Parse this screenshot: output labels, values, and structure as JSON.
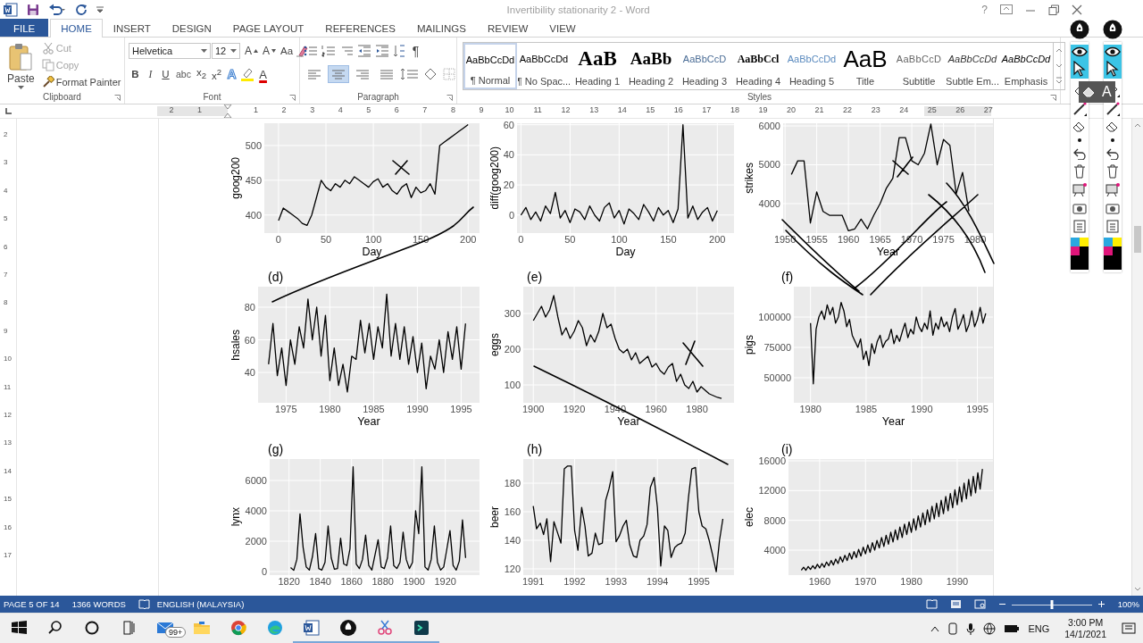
{
  "window": {
    "title": "Invertibility stationarity 2 - Word",
    "help": "?"
  },
  "tabs": [
    {
      "label": "FILE",
      "kind": "file",
      "selected": false
    },
    {
      "label": "HOME",
      "kind": "tab",
      "selected": true
    },
    {
      "label": "INSERT",
      "kind": "tab",
      "selected": false
    },
    {
      "label": "DESIGN",
      "kind": "tab",
      "selected": false
    },
    {
      "label": "PAGE LAYOUT",
      "kind": "tab",
      "selected": false
    },
    {
      "label": "REFERENCES",
      "kind": "tab",
      "selected": false
    },
    {
      "label": "MAILINGS",
      "kind": "tab",
      "selected": false
    },
    {
      "label": "REVIEW",
      "kind": "tab",
      "selected": false
    },
    {
      "label": "VIEW",
      "kind": "tab",
      "selected": false
    }
  ],
  "clipboard": {
    "group": "Clipboard",
    "paste": "Paste",
    "items": [
      {
        "label": "Cut",
        "kind": "cut",
        "disabled": true
      },
      {
        "label": "Copy",
        "kind": "copy",
        "disabled": true
      },
      {
        "label": "Format Painter",
        "kind": "painter",
        "disabled": false
      }
    ]
  },
  "font": {
    "group": "Font",
    "name": "Helvetica",
    "size": "12",
    "row1": [
      {
        "label": "A",
        "kind": "grow"
      },
      {
        "label": "A",
        "kind": "shrink"
      },
      {
        "label": "Aa",
        "kind": "case"
      }
    ],
    "row2": [
      {
        "label": "B",
        "kind": "bold"
      },
      {
        "label": "I",
        "kind": "italic"
      },
      {
        "label": "U",
        "kind": "underline"
      },
      {
        "label": "abc",
        "kind": "strike"
      },
      {
        "label": "x$_{2}$",
        "kind": "subscript"
      },
      {
        "label": "x$^{2}$",
        "kind": "superscript"
      },
      {
        "label": "A",
        "kind": "effects"
      },
      {
        "label": "A",
        "kind": "color"
      }
    ]
  },
  "paragraph": {
    "group": "Paragraph",
    "marks": "¶",
    "align": [
      {
        "selected": false
      },
      {
        "selected": true
      },
      {
        "selected": false
      },
      {
        "selected": false
      }
    ]
  },
  "styles": {
    "group": "Styles",
    "items": [
      {
        "sample": "AaBbCcDd",
        "name": "¶ Normal",
        "kind": "normal",
        "selected": true
      },
      {
        "sample": "AaBbCcDd",
        "name": "¶ No Spac...",
        "kind": "plain",
        "selected": false
      },
      {
        "sample": "AaB",
        "name": "Heading 1",
        "kind": "heading1",
        "selected": false
      },
      {
        "sample": "AaBb",
        "name": "Heading 2",
        "kind": "heading2",
        "selected": false
      },
      {
        "sample": "AaBbCcD",
        "name": "Heading 3",
        "kind": "heading3",
        "selected": false
      },
      {
        "sample": "AaBbCcl",
        "name": "Heading 4",
        "kind": "heading4",
        "selected": false
      },
      {
        "sample": "AaBbCcDd",
        "name": "Heading 5",
        "kind": "heading5",
        "selected": false
      },
      {
        "sample": "AaB",
        "name": "Title",
        "kind": "title",
        "selected": false
      },
      {
        "sample": "AaBbCcD",
        "name": "Subtitle",
        "kind": "subtitle",
        "selected": false
      },
      {
        "sample": "AaBbCcDd",
        "name": "Subtle Em...",
        "kind": "subtle",
        "selected": false
      },
      {
        "sample": "AaBbCcDd",
        "name": "Emphasis",
        "kind": "emphasis",
        "selected": false
      }
    ]
  },
  "ruler": {
    "marks": [
      "2",
      "1",
      "1",
      "2",
      "3",
      "4",
      "5",
      "6",
      "7",
      "8",
      "9",
      "10",
      "11",
      "12",
      "13",
      "14",
      "15",
      "16",
      "17",
      "18",
      "19",
      "20",
      "21",
      "22",
      "23",
      "24",
      "25",
      "26",
      "27"
    ]
  },
  "vertical_ruler": {
    "marks": [
      "2",
      "3",
      "4",
      "5",
      "6",
      "7",
      "8",
      "9",
      "10",
      "11",
      "12",
      "13",
      "14",
      "15",
      "16",
      "17"
    ]
  },
  "panels": [
    {
      "chart_data": {
        "type": "line",
        "xlabel": "Day",
        "ylabel": "goog200",
        "grid": true,
        "xlim": [
          -15,
          212
        ],
        "ylim": [
          374,
          532
        ],
        "xticks": [
          0,
          50,
          100,
          150,
          200
        ],
        "yticks": [
          500,
          450,
          400
        ],
        "x": [
          0,
          5,
          10,
          15,
          20,
          25,
          30,
          35,
          40,
          45,
          50,
          55,
          60,
          65,
          70,
          75,
          80,
          85,
          90,
          95,
          100,
          105,
          110,
          115,
          120,
          125,
          130,
          135,
          140,
          145,
          150,
          155,
          160,
          165,
          170,
          175,
          180,
          185,
          190,
          195,
          200
        ],
        "series": [
          {
            "color": "#000000",
            "values": [
              392,
              410,
              405,
              400,
              395,
              388,
              385,
              400,
              425,
              450,
              440,
              435,
              445,
              440,
              450,
              445,
              455,
              450,
              445,
              440,
              448,
              452,
              440,
              445,
              435,
              430,
              440,
              445,
              425,
              440,
              432,
              435,
              445,
              430,
              500,
              505,
              510,
              515,
              520,
              525,
              530
            ]
          }
        ]
      }
    },
    {
      "chart_data": {
        "type": "line",
        "xlabel": "Day",
        "ylabel": "diff(goog200)",
        "grid": true,
        "xlim": [
          -4,
          217
        ],
        "ylim": [
          -12,
          61
        ],
        "xticks": [
          0,
          50,
          100,
          150,
          200
        ],
        "yticks": [
          60,
          40,
          20,
          0
        ],
        "x": [
          0,
          5,
          10,
          15,
          20,
          25,
          30,
          35,
          40,
          45,
          50,
          55,
          60,
          65,
          70,
          75,
          80,
          85,
          90,
          95,
          100,
          105,
          110,
          115,
          120,
          125,
          130,
          135,
          140,
          145,
          150,
          155,
          160,
          165,
          170,
          175,
          180,
          185,
          190,
          195,
          200
        ],
        "series": [
          {
            "color": "#000000",
            "values": [
              0,
              5,
              -3,
              2,
              -4,
              6,
              1,
              15,
              -2,
              3,
              -5,
              4,
              2,
              -3,
              6,
              0,
              -4,
              5,
              8,
              -2,
              3,
              -6,
              4,
              1,
              -3,
              7,
              2,
              -4,
              5,
              0,
              3,
              -5,
              4,
              60,
              -2,
              6,
              -3,
              2,
              5,
              -4,
              3
            ]
          }
        ]
      }
    },
    {
      "chart_data": {
        "type": "line",
        "xlabel": "Year",
        "ylabel": "strikes",
        "grid": true,
        "xlim": [
          1949.7,
          1982.8
        ],
        "ylim": [
          3241,
          6069
        ],
        "xticks": [
          1950,
          1955,
          1960,
          1965,
          1970,
          1975,
          1980
        ],
        "yticks": [
          6000,
          5000,
          4000
        ],
        "x": [
          1951,
          1952,
          1953,
          1954,
          1955,
          1956,
          1957,
          1958,
          1959,
          1960,
          1961,
          1962,
          1963,
          1964,
          1965,
          1966,
          1967,
          1968,
          1969,
          1970,
          1971,
          1972,
          1973,
          1974,
          1975,
          1976,
          1977,
          1978,
          1979
        ],
        "series": [
          {
            "color": "#000000",
            "values": [
              4750,
              5100,
              5100,
              3500,
              4300,
              3800,
              3700,
              3700,
              3700,
              3300,
              3350,
              3600,
              3350,
              3700,
              4000,
              4400,
              4650,
              5700,
              5700,
              5100,
              5000,
              5300,
              6050,
              5000,
              5650,
              5500,
              4250,
              4800,
              3800
            ]
          }
        ]
      }
    },
    {
      "label": "(d)",
      "chart_data": {
        "type": "line",
        "xlabel": "Year",
        "ylabel": "hsales",
        "grid": true,
        "xlim": [
          1971.8,
          1997.1
        ],
        "ylim": [
          21.4,
          92.6
        ],
        "xticks": [
          1975,
          1980,
          1985,
          1990,
          1995
        ],
        "yticks": [
          80,
          60,
          40
        ],
        "x": [
          1973,
          1973.5,
          1974,
          1974.5,
          1975,
          1975.5,
          1976,
          1976.5,
          1977,
          1977.5,
          1978,
          1978.5,
          1979,
          1979.5,
          1980,
          1980.5,
          1981,
          1981.5,
          1982,
          1982.5,
          1983,
          1983.5,
          1984,
          1984.5,
          1985,
          1985.5,
          1986,
          1986.5,
          1987,
          1987.5,
          1988,
          1988.5,
          1989,
          1989.5,
          1990,
          1990.5,
          1991,
          1991.5,
          1992,
          1992.5,
          1993,
          1993.5,
          1994,
          1994.5,
          1995,
          1995.5
        ],
        "series": [
          {
            "color": "#000000",
            "values": [
              45,
              70,
              38,
              55,
              32,
              60,
              45,
              68,
              55,
              85,
              60,
              80,
              50,
              75,
              35,
              55,
              32,
              45,
              28,
              50,
              48,
              72,
              52,
              70,
              48,
              68,
              55,
              88,
              50,
              70,
              48,
              68,
              45,
              62,
              40,
              58,
              30,
              50,
              42,
              60,
              40,
              65,
              48,
              68,
              42,
              70
            ]
          }
        ]
      }
    },
    {
      "label": "(e)",
      "chart_data": {
        "type": "line",
        "xlabel": "Year",
        "ylabel": "eggs",
        "grid": true,
        "xlim": [
          1895.1,
          1998.1
        ],
        "ylim": [
          50,
          375
        ],
        "xticks": [
          1900,
          1920,
          1940,
          1960,
          1980
        ],
        "yticks": [
          300,
          200,
          100
        ],
        "x": [
          1900,
          1902,
          1904,
          1906,
          1908,
          1910,
          1912,
          1914,
          1916,
          1918,
          1920,
          1922,
          1924,
          1926,
          1928,
          1930,
          1932,
          1934,
          1936,
          1938,
          1940,
          1942,
          1944,
          1946,
          1948,
          1950,
          1952,
          1954,
          1956,
          1958,
          1960,
          1962,
          1964,
          1966,
          1968,
          1970,
          1972,
          1974,
          1976,
          1978,
          1980,
          1982,
          1984,
          1986,
          1988,
          1990,
          1992
        ],
        "series": [
          {
            "color": "#000000",
            "values": [
              280,
              300,
              320,
              290,
              310,
              350,
              290,
              240,
              260,
              230,
              250,
              280,
              260,
              210,
              240,
              220,
              250,
              300,
              260,
              270,
              230,
              200,
              190,
              200,
              170,
              190,
              160,
              170,
              180,
              150,
              160,
              140,
              130,
              150,
              160,
              110,
              130,
              100,
              90,
              110,
              80,
              95,
              85,
              75,
              70,
              65,
              62
            ]
          }
        ]
      }
    },
    {
      "label": "(f)",
      "chart_data": {
        "type": "line",
        "xlabel": "Year",
        "ylabel": "pigs",
        "grid": true,
        "xlim": [
          1978.5,
          1996.4
        ],
        "ylim": [
          29420,
          125000
        ],
        "xticks": [
          1980,
          1985,
          1990,
          1995
        ],
        "yticks": [
          100000,
          75000,
          50000
        ],
        "x": [
          1980,
          1980.25,
          1980.5,
          1980.75,
          1981,
          1981.25,
          1981.5,
          1981.75,
          1982,
          1982.25,
          1982.5,
          1982.75,
          1983,
          1983.25,
          1983.5,
          1983.75,
          1984,
          1984.25,
          1984.5,
          1984.75,
          1985,
          1985.25,
          1985.5,
          1985.75,
          1986,
          1986.25,
          1986.5,
          1986.75,
          1987,
          1987.25,
          1987.5,
          1987.75,
          1988,
          1988.25,
          1988.5,
          1988.75,
          1989,
          1989.25,
          1989.5,
          1989.75,
          1990,
          1990.25,
          1990.5,
          1990.75,
          1991,
          1991.25,
          1991.5,
          1991.75,
          1992,
          1992.25,
          1992.5,
          1992.75,
          1993,
          1993.25,
          1993.5,
          1993.75,
          1994,
          1994.25,
          1994.5,
          1994.75,
          1995,
          1995.25,
          1995.5,
          1995.75
        ],
        "series": [
          {
            "color": "#000000",
            "values": [
              95000,
              45000,
              90000,
              100000,
              105000,
              98000,
              110000,
              102000,
              108000,
              95000,
              100000,
              112000,
              105000,
              92000,
              98000,
              85000,
              80000,
              75000,
              82000,
              65000,
              72000,
              60000,
              78000,
              70000,
              80000,
              85000,
              75000,
              80000,
              82000,
              90000,
              78000,
              85000,
              80000,
              88000,
              95000,
              83000,
              90000,
              86000,
              100000,
              92000,
              88000,
              95000,
              90000,
              105000,
              85000,
              95000,
              90000,
              100000,
              92000,
              96000,
              88000,
              100000,
              107000,
              90000,
              95000,
              102000,
              88000,
              94000,
              105000,
              92000,
              98000,
              108000,
              95000,
              103000
            ]
          }
        ]
      }
    },
    {
      "label": "(g)",
      "chart_data": {
        "type": "line",
        "ylabel": "lynx",
        "grid": true,
        "xlim": [
          1807.6,
          1941.9
        ],
        "ylim": [
          -235,
          7411
        ],
        "xticks": [
          1820,
          1840,
          1860,
          1880,
          1900,
          1920
        ],
        "yticks": [
          6000,
          4000,
          2000,
          0
        ],
        "x": [
          1821,
          1823,
          1825,
          1827,
          1829,
          1831,
          1833,
          1835,
          1837,
          1839,
          1841,
          1843,
          1845,
          1847,
          1849,
          1851,
          1853,
          1855,
          1857,
          1859,
          1861,
          1863,
          1865,
          1867,
          1869,
          1871,
          1873,
          1875,
          1877,
          1879,
          1881,
          1883,
          1885,
          1887,
          1889,
          1891,
          1893,
          1895,
          1897,
          1899,
          1901,
          1903,
          1905,
          1907,
          1909,
          1911,
          1913,
          1915,
          1917,
          1919,
          1921,
          1923,
          1925,
          1927,
          1929,
          1931,
          1933
        ],
        "series": [
          {
            "color": "#000000",
            "values": [
              270,
              80,
              800,
              3800,
              1600,
              300,
              100,
              1000,
              2500,
              200,
              100,
              600,
              3000,
              900,
              150,
              200,
              2200,
              500,
              400,
              1500,
              6900,
              500,
              200,
              800,
              2400,
              400,
              100,
              1100,
              2100,
              300,
              200,
              900,
              3000,
              400,
              200,
              600,
              2600,
              800,
              200,
              600,
              4000,
              2500,
              6900,
              300,
              100,
              800,
              3000,
              600,
              100,
              300,
              1500,
              2700,
              400,
              100,
              700,
              3400,
              900
            ]
          }
        ]
      }
    },
    {
      "label": "(h)",
      "chart_data": {
        "type": "line",
        "ylabel": "beer",
        "grid": true,
        "xlim": [
          1990.76,
          1995.85
        ],
        "ylim": [
          115.6,
          196.9
        ],
        "xticks": [
          1991,
          1992,
          1993,
          1994,
          1995
        ],
        "yticks": [
          180,
          160,
          140,
          120
        ],
        "x": [
          1991,
          1991.08,
          1991.17,
          1991.25,
          1991.33,
          1991.42,
          1991.5,
          1991.58,
          1991.67,
          1991.75,
          1991.83,
          1991.92,
          1992,
          1992.08,
          1992.17,
          1992.25,
          1992.33,
          1992.42,
          1992.5,
          1992.58,
          1992.67,
          1992.75,
          1992.83,
          1992.92,
          1993,
          1993.08,
          1993.17,
          1993.25,
          1993.33,
          1993.42,
          1993.5,
          1993.58,
          1993.67,
          1993.75,
          1993.83,
          1993.92,
          1994,
          1994.08,
          1994.17,
          1994.25,
          1994.33,
          1994.42,
          1994.5,
          1994.58,
          1994.67,
          1994.75,
          1994.83,
          1994.92,
          1995,
          1995.08,
          1995.17,
          1995.25,
          1995.33,
          1995.42,
          1995.5,
          1995.58
        ],
        "series": [
          {
            "color": "#000000",
            "values": [
              164,
              148,
              152,
              144,
              155,
              125,
              153,
              146,
              138,
              190,
              192,
              192,
              147,
              133,
              163,
              150,
              129,
              131,
              145,
              137,
              138,
              168,
              176,
              188,
              139,
              143,
              150,
              154,
              137,
              129,
              128,
              140,
              143,
              151,
              177,
              184,
              163,
              122,
              150,
              147,
              128,
              135,
              137,
              138,
              145,
              170,
              190,
              191,
              160,
              150,
              148,
              140,
              130,
              118,
              140,
              155
            ]
          }
        ]
      }
    },
    {
      "label": "(i)",
      "chart_data": {
        "type": "line",
        "ylabel": "elec",
        "grid": true,
        "xlim": [
          1953.2,
          1997.8
        ],
        "ylim": [
          640,
          16240
        ],
        "xticks": [
          1960,
          1970,
          1980,
          1990
        ],
        "yticks": [
          16000,
          12000,
          8000,
          4000
        ],
        "x": [
          1956,
          1956.5,
          1957,
          1957.5,
          1958,
          1958.5,
          1959,
          1959.5,
          1960,
          1960.5,
          1961,
          1961.5,
          1962,
          1962.5,
          1963,
          1963.5,
          1964,
          1964.5,
          1965,
          1965.5,
          1966,
          1966.5,
          1967,
          1967.5,
          1968,
          1968.5,
          1969,
          1969.5,
          1970,
          1970.5,
          1971,
          1971.5,
          1972,
          1972.5,
          1973,
          1973.5,
          1974,
          1974.5,
          1975,
          1975.5,
          1976,
          1976.5,
          1977,
          1977.5,
          1978,
          1978.5,
          1979,
          1979.5,
          1980,
          1980.5,
          1981,
          1981.5,
          1982,
          1982.5,
          1983,
          1983.5,
          1984,
          1984.5,
          1985,
          1985.5,
          1986,
          1986.5,
          1987,
          1987.5,
          1988,
          1988.5,
          1989,
          1989.5,
          1990,
          1990.5,
          1991,
          1991.5,
          1992,
          1992.5,
          1993,
          1993.5,
          1994,
          1994.5,
          1995,
          1995.5
        ],
        "series": [
          {
            "color": "#000000",
            "values": [
              1300,
              1700,
              1300,
              1800,
              1400,
              1900,
              1500,
              2100,
              1600,
              2200,
              1700,
              2400,
              1900,
              2600,
              2000,
              2800,
              2200,
              3100,
              2400,
              3300,
              2600,
              3600,
              2800,
              3800,
              3000,
              4100,
              3200,
              4400,
              3500,
              4700,
              3700,
              5000,
              4000,
              5300,
              4300,
              5700,
              4500,
              6000,
              4800,
              6400,
              5100,
              6700,
              5400,
              7100,
              5700,
              7500,
              6100,
              7800,
              6400,
              8200,
              6700,
              8600,
              7100,
              9000,
              7400,
              9400,
              7800,
              9900,
              8200,
              10300,
              8500,
              10700,
              8900,
              11200,
              9300,
              11600,
              9700,
              12100,
              10100,
              12500,
              10500,
              13000,
              10900,
              13500,
              11300,
              13900,
              11700,
              14400,
              12200,
              14900
            ]
          }
        ]
      }
    }
  ],
  "pen_toolbars": [
    {
      "popup": false
    },
    {
      "popup": true
    }
  ],
  "pen_popup_letter": "A",
  "status_bar": {
    "page": "PAGE 5 OF 14",
    "words": "1366 WORDS",
    "language": "ENGLISH (MALAYSIA)",
    "zoom": "100%",
    "zoom_slider": {
      "level": 0.5
    }
  },
  "taskbar": {
    "apps": [
      {
        "kind": "start",
        "running": false
      },
      {
        "kind": "search",
        "running": false
      },
      {
        "kind": "cortana",
        "running": false
      },
      {
        "kind": "taskview",
        "running": false
      },
      {
        "kind": "mail",
        "running": false,
        "badge": "99+"
      },
      {
        "kind": "explorer",
        "running": false
      },
      {
        "kind": "chrome",
        "running": false
      },
      {
        "kind": "edge",
        "running": false
      },
      {
        "kind": "word",
        "running": true
      },
      {
        "kind": "pen",
        "running": true
      },
      {
        "kind": "snip",
        "running": true
      },
      {
        "kind": "terminal",
        "running": true
      }
    ],
    "language": "ENG",
    "time": "3:00 PM",
    "date": "14/1/2021"
  }
}
